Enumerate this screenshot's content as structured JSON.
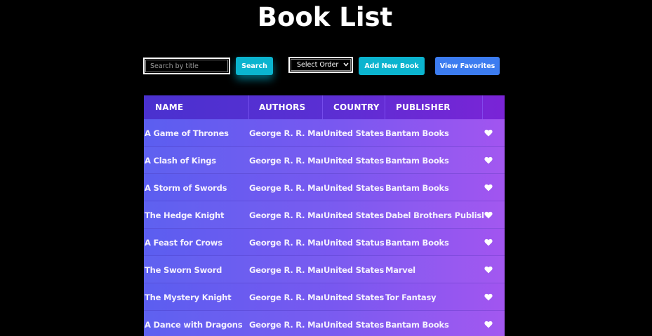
{
  "header": {
    "title": "Book List"
  },
  "toolbar": {
    "search_placeholder": "Search by title",
    "search_label": "Search",
    "order_selected": "Select Order",
    "add_label": "Add New Book",
    "favorites_label": "View Favorites"
  },
  "table": {
    "columns": [
      "NAME",
      "AUTHORS",
      "COUNTRY",
      "PUBLISHER"
    ],
    "rows": [
      {
        "name": "A Game of Thrones",
        "authors": "George R. R. Martin",
        "country": "United States",
        "publisher": "Bantam Books",
        "favorite_icon": "heart-icon"
      },
      {
        "name": "A Clash of Kings",
        "authors": "George R. R. Martin",
        "country": "United States",
        "publisher": "Bantam Books",
        "favorite_icon": "heart-icon"
      },
      {
        "name": "A Storm of Swords",
        "authors": "George R. R. Martin",
        "country": "United States",
        "publisher": "Bantam Books",
        "favorite_icon": "heart-icon"
      },
      {
        "name": "The Hedge Knight",
        "authors": "George R. R. Martin",
        "country": "United States",
        "publisher": "Dabel Brothers Publishing",
        "favorite_icon": "heart-icon"
      },
      {
        "name": "A Feast for Crows",
        "authors": "George R. R. Martin",
        "country": "United Status",
        "publisher": "Bantam Books",
        "favorite_icon": "heart-icon"
      },
      {
        "name": "The Sworn Sword",
        "authors": "George R. R. Martin",
        "country": "United States",
        "publisher": "Marvel",
        "favorite_icon": "heart-icon"
      },
      {
        "name": "The Mystery Knight",
        "authors": "George R. R. Martin",
        "country": "United States",
        "publisher": "Tor Fantasy",
        "favorite_icon": "heart-icon"
      },
      {
        "name": "A Dance with Dragons",
        "authors": "George R. R. Martin",
        "country": "United States",
        "publisher": "Bantam Books",
        "favorite_icon": "heart-icon"
      }
    ]
  },
  "colors": {
    "background": "#000000",
    "accent_cyan": "#0bb4cf",
    "accent_blue": "#3c7cf0",
    "header_gradient_start": "#4a31cf",
    "header_gradient_end": "#7a24d6",
    "row_gradient_start": "#5b5ef0",
    "row_gradient_end": "#a255f0"
  }
}
